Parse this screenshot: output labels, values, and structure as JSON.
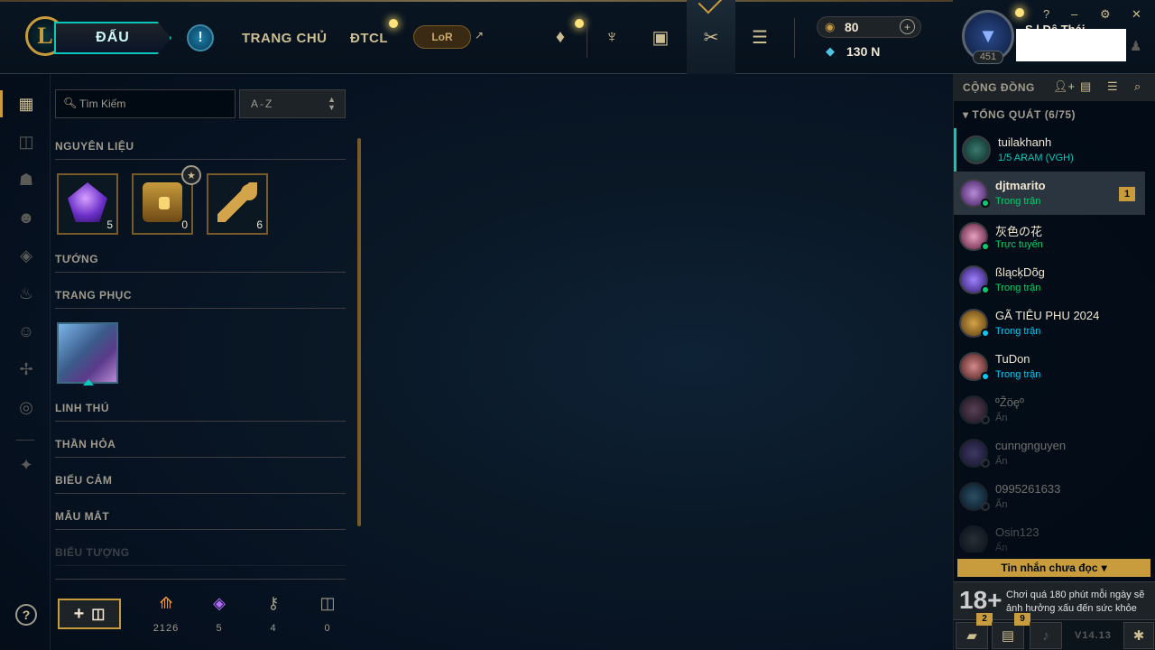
{
  "header": {
    "play_label": "ĐẤU",
    "alert_icon": "!",
    "nav_home": "TRANG CHỦ",
    "nav_tft": "ĐTCL",
    "lor_label": "LoR",
    "currency": {
      "rp": "80",
      "be": "130 N",
      "add": "+"
    },
    "profile": {
      "level": "451",
      "name": "S  l  Đệ  Thái"
    },
    "window": {
      "help": "?",
      "minimize": "‒",
      "settings": "⚙",
      "close": "✕"
    }
  },
  "leftbar": {
    "items": [
      "grid-icon",
      "chest-tab-icon",
      "champion-helmet-icon",
      "skin-mask-icon",
      "ward-icon",
      "emote-flame-icon",
      "smiley-icon",
      "champion-wings-icon",
      "profile-icon",
      "crafting-arrow-icon"
    ],
    "help": "?"
  },
  "loot": {
    "search_placeholder": "Tìm Kiếm",
    "sort_value": "A-Z",
    "sections": {
      "materials": "NGUYÊN LIỆU",
      "champions": "TƯỚNG",
      "skins": "TRANG PHỤC",
      "pets": "LINH THÚ",
      "wards": "THẦN HỎA",
      "emotes": "BIỂU CẢM",
      "eyes": "MẪU MẮT",
      "icons": "BIỂU TƯỢNG"
    },
    "materials": [
      {
        "name": "mythic-essence",
        "count": "5"
      },
      {
        "name": "hextech-chest",
        "count": "0"
      },
      {
        "name": "hextech-key",
        "count": "6"
      }
    ],
    "craft_button_plus": "+",
    "stats": [
      {
        "name": "orange-essence",
        "value": "2126",
        "color": "#f0963c"
      },
      {
        "name": "mythic-essence",
        "value": "5",
        "color": "#b46eff"
      },
      {
        "name": "key-fragment",
        "value": "4",
        "color": "#a09b8c"
      },
      {
        "name": "chest",
        "value": "0",
        "color": "#a09b8c"
      }
    ]
  },
  "social": {
    "title": "CỘNG ĐỒNG",
    "group": "TỔNG QUÁT (6/75)",
    "friends": [
      {
        "name": "tuilakhanh",
        "status": "1/5 ARAM (VGH)",
        "state": "lobby"
      },
      {
        "name": "djtmarito",
        "status": "Trong trận",
        "state": "ingame",
        "badge": "1"
      },
      {
        "name": "灰色の花",
        "status": "Trực tuyến",
        "state": "online"
      },
      {
        "name": "ßlącķDõg",
        "status": "Trong trận",
        "state": "ingame"
      },
      {
        "name": "GÃ TIÊU PHU 2024",
        "status": "Trong trận",
        "state": "ingame-blue"
      },
      {
        "name": "TuDon",
        "status": "Trong trận",
        "state": "ingame-blue"
      },
      {
        "name": "ºŽöęº",
        "status": "Ẩn",
        "state": "away"
      },
      {
        "name": "cunngnguyen",
        "status": "Ẩn",
        "state": "away"
      },
      {
        "name": "0995261633",
        "status": "Ẩn",
        "state": "away"
      },
      {
        "name": "Osin123",
        "status": "Ẩn",
        "state": "away"
      }
    ],
    "unread_label": "Tin nhắn chưa đọc",
    "warning_age": "18+",
    "warning_text": "Chơi quá 180 phút mỗi ngày sẽ ảnh hưởng xấu đến sức khỏe",
    "chat_badge": "2",
    "mission_badge": "9",
    "version": "V14.13"
  }
}
